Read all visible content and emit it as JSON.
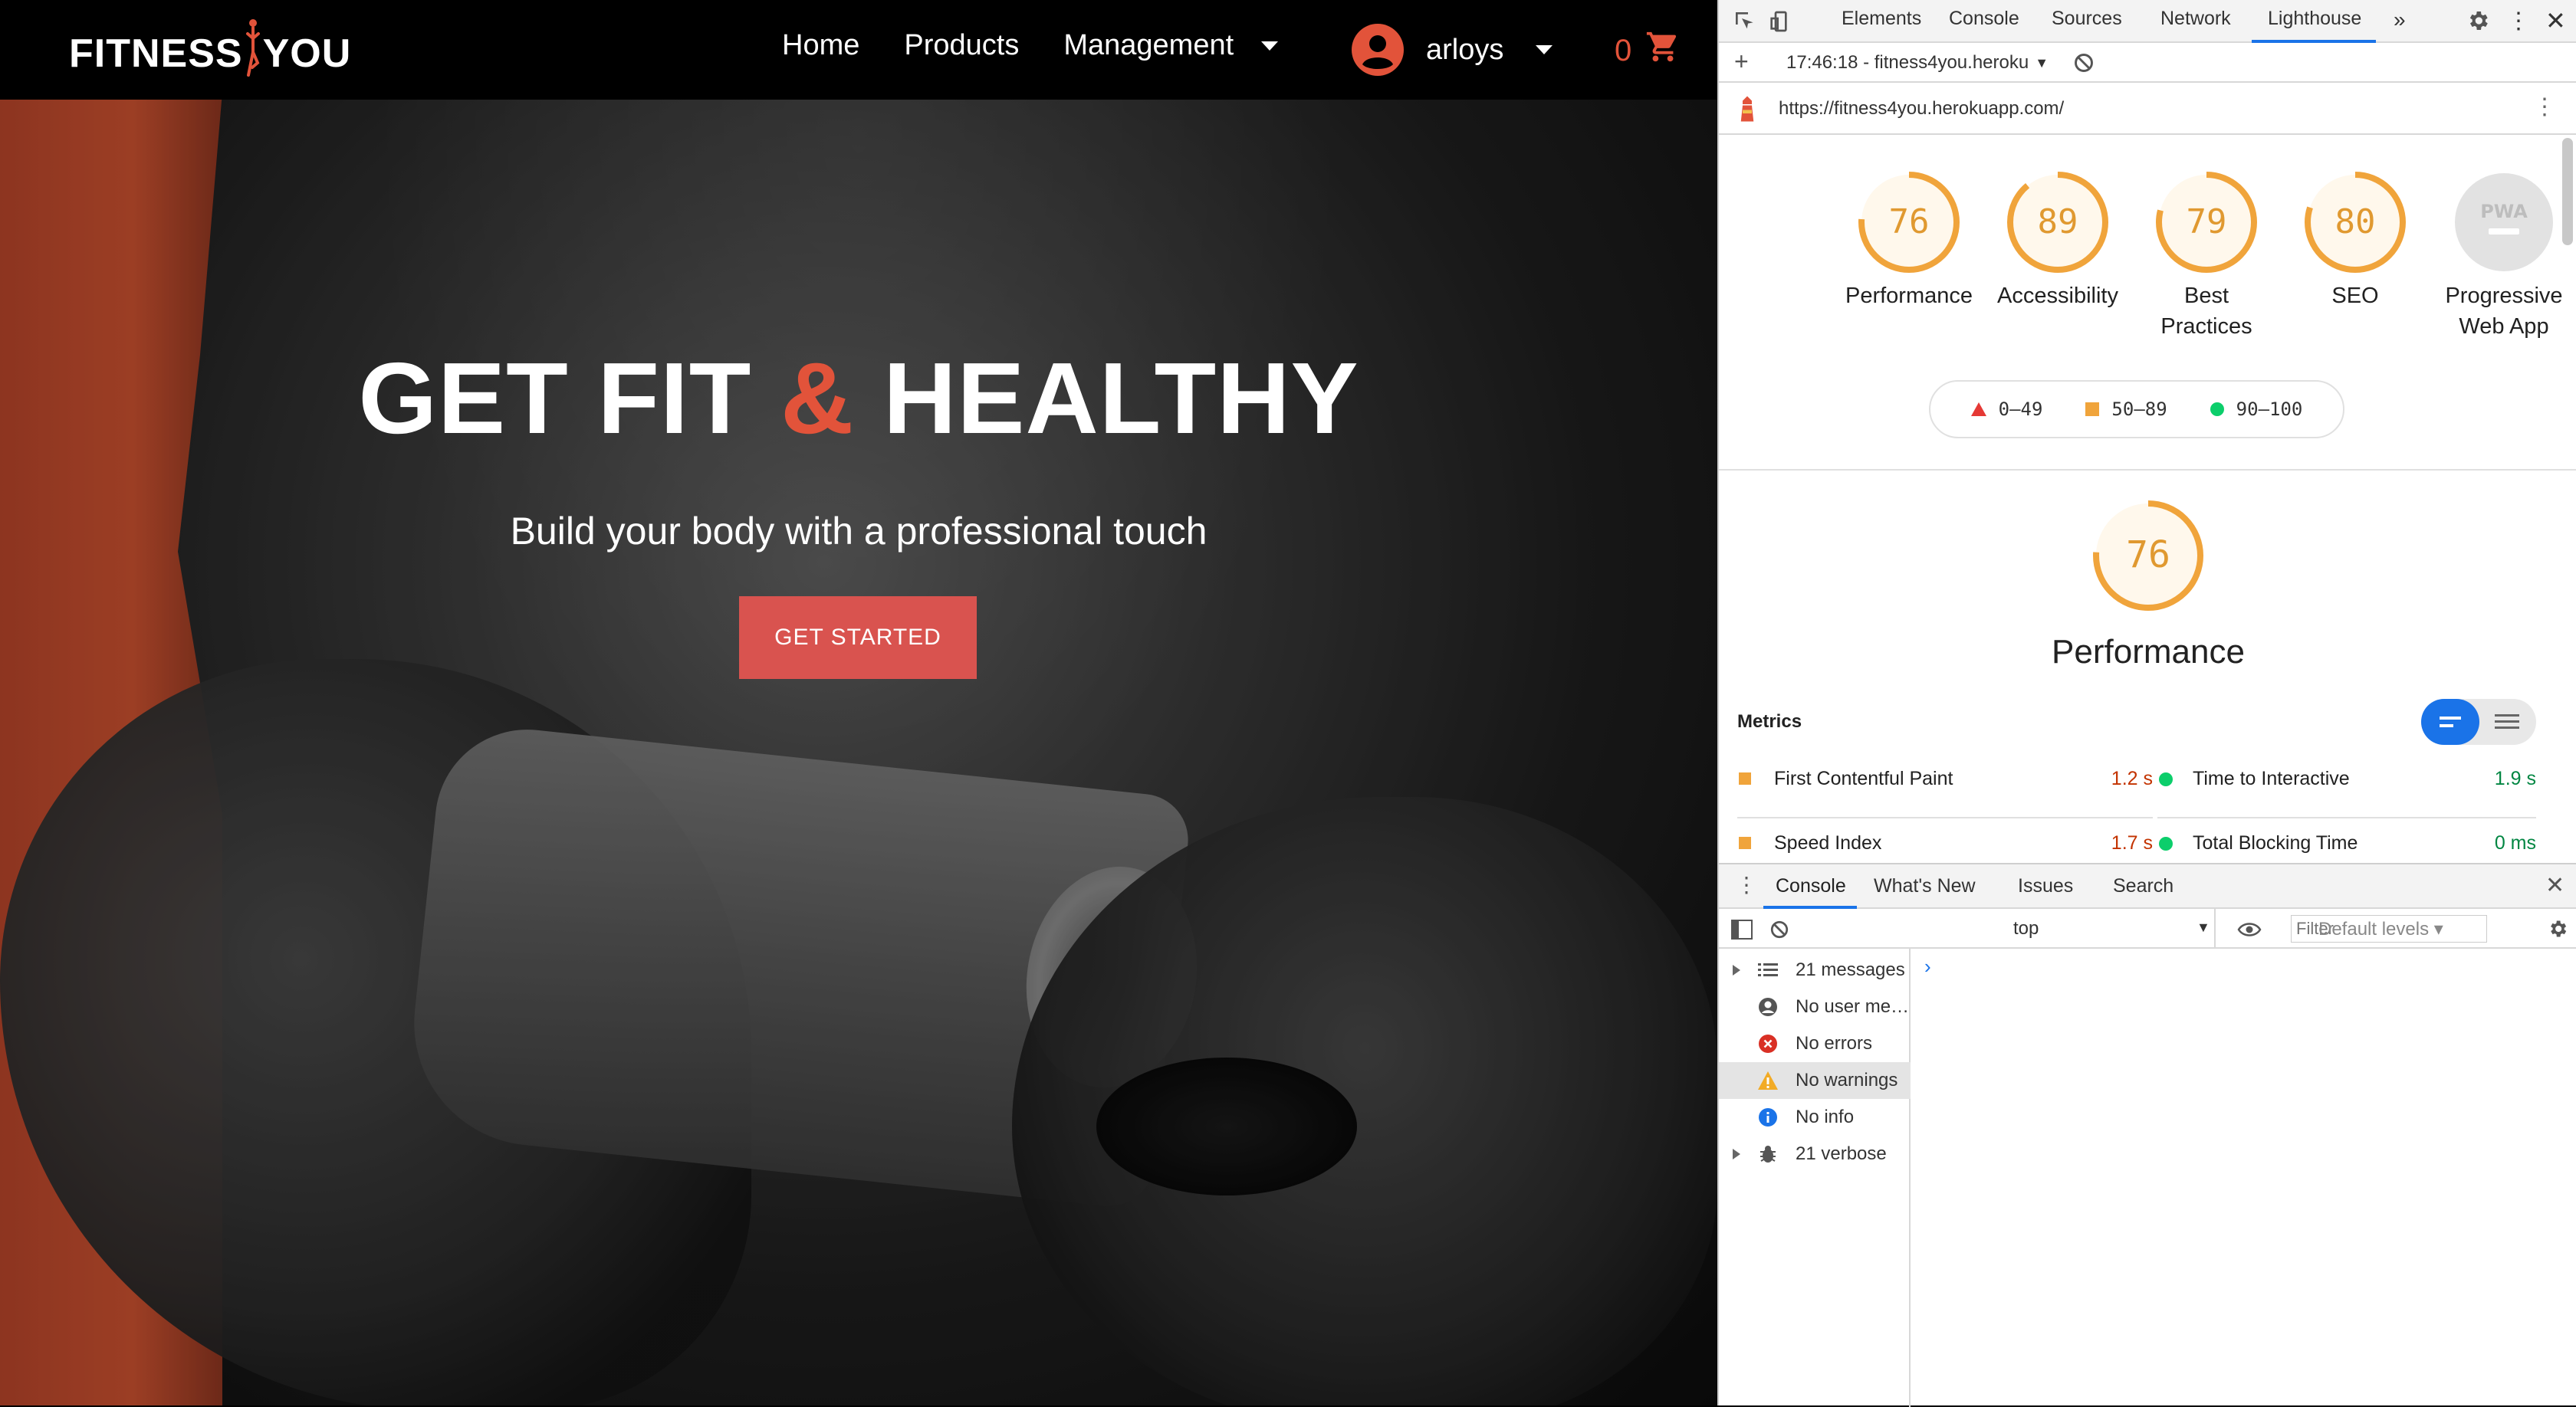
{
  "site": {
    "logo_left": "FITNESS",
    "logo_right": "YOU",
    "nav": [
      "Home",
      "Products",
      "Management"
    ],
    "username": "arloys",
    "cart_count": "0",
    "hero_title_a": "GET FIT",
    "hero_title_amp": "&",
    "hero_title_b": "HEALTHY",
    "hero_subtitle": "Build your body with a professional touch",
    "cta_label": "GET STARTED",
    "accent_color": "#e2533a"
  },
  "devtools": {
    "tabs": [
      "Elements",
      "Console",
      "Sources",
      "Network",
      "Lighthouse"
    ],
    "active_tab": "Lighthouse",
    "report_select": "17:46:18 - fitness4you.heroku",
    "url": "https://fitness4you.herokuapp.com/",
    "scores": [
      {
        "label_1": "Performance",
        "label_2": "",
        "score": "76",
        "value": 76
      },
      {
        "label_1": "Accessibility",
        "label_2": "",
        "score": "89",
        "value": 89
      },
      {
        "label_1": "Best",
        "label_2": "Practices",
        "score": "79",
        "value": 79
      },
      {
        "label_1": "SEO",
        "label_2": "",
        "score": "80",
        "value": 80
      }
    ],
    "pwa": {
      "label_1": "Progressive",
      "label_2": "Web App",
      "badge": "PWA"
    },
    "legend": [
      "0–49",
      "50–89",
      "90–100"
    ],
    "perf_score": "76",
    "perf_title": "Performance",
    "metrics_heading": "Metrics",
    "metrics": [
      {
        "name": "First Contentful Paint",
        "value": "1.2 s",
        "status": "average"
      },
      {
        "name": "Time to Interactive",
        "value": "1.9 s",
        "status": "pass"
      },
      {
        "name": "Speed Index",
        "value": "1.7 s",
        "status": "average"
      },
      {
        "name": "Total Blocking Time",
        "value": "0 ms",
        "status": "pass"
      }
    ]
  },
  "drawer": {
    "tabs": [
      "Console",
      "What's New",
      "Issues",
      "Search"
    ],
    "context": "top",
    "filter_placeholder": "Filter",
    "levels": "Default levels ▾",
    "sidebar": [
      {
        "label": "21 messages",
        "icon": "list-icon"
      },
      {
        "label": "No user me…",
        "icon": "user-icon"
      },
      {
        "label": "No errors",
        "icon": "error-icon"
      },
      {
        "label": "No warnings",
        "icon": "warning-icon"
      },
      {
        "label": "No info",
        "icon": "info-icon"
      },
      {
        "label": "21 verbose",
        "icon": "bug-icon"
      }
    ]
  }
}
